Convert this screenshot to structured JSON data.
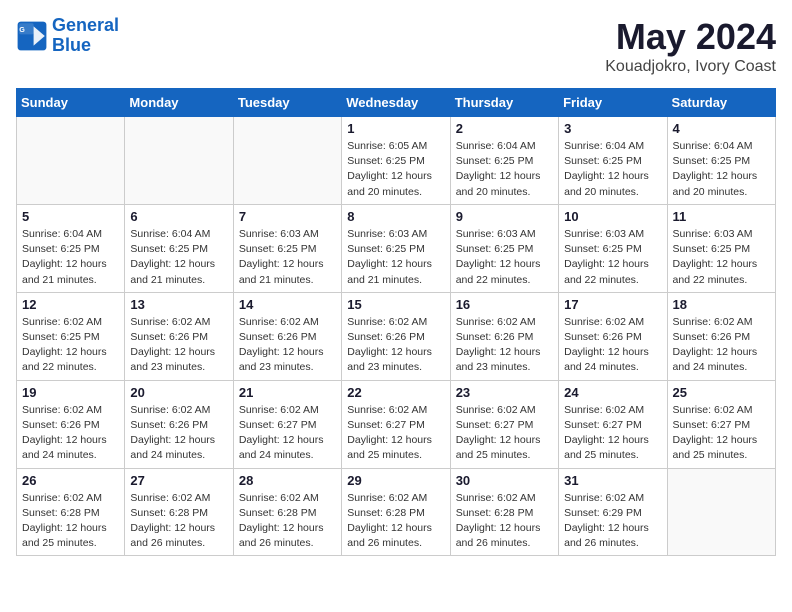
{
  "logo": {
    "line1": "General",
    "line2": "Blue"
  },
  "title": "May 2024",
  "location": "Kouadjokro, Ivory Coast",
  "weekdays": [
    "Sunday",
    "Monday",
    "Tuesday",
    "Wednesday",
    "Thursday",
    "Friday",
    "Saturday"
  ],
  "weeks": [
    [
      {
        "day": "",
        "info": ""
      },
      {
        "day": "",
        "info": ""
      },
      {
        "day": "",
        "info": ""
      },
      {
        "day": "1",
        "info": "Sunrise: 6:05 AM\nSunset: 6:25 PM\nDaylight: 12 hours\nand 20 minutes."
      },
      {
        "day": "2",
        "info": "Sunrise: 6:04 AM\nSunset: 6:25 PM\nDaylight: 12 hours\nand 20 minutes."
      },
      {
        "day": "3",
        "info": "Sunrise: 6:04 AM\nSunset: 6:25 PM\nDaylight: 12 hours\nand 20 minutes."
      },
      {
        "day": "4",
        "info": "Sunrise: 6:04 AM\nSunset: 6:25 PM\nDaylight: 12 hours\nand 20 minutes."
      }
    ],
    [
      {
        "day": "5",
        "info": "Sunrise: 6:04 AM\nSunset: 6:25 PM\nDaylight: 12 hours\nand 21 minutes."
      },
      {
        "day": "6",
        "info": "Sunrise: 6:04 AM\nSunset: 6:25 PM\nDaylight: 12 hours\nand 21 minutes."
      },
      {
        "day": "7",
        "info": "Sunrise: 6:03 AM\nSunset: 6:25 PM\nDaylight: 12 hours\nand 21 minutes."
      },
      {
        "day": "8",
        "info": "Sunrise: 6:03 AM\nSunset: 6:25 PM\nDaylight: 12 hours\nand 21 minutes."
      },
      {
        "day": "9",
        "info": "Sunrise: 6:03 AM\nSunset: 6:25 PM\nDaylight: 12 hours\nand 22 minutes."
      },
      {
        "day": "10",
        "info": "Sunrise: 6:03 AM\nSunset: 6:25 PM\nDaylight: 12 hours\nand 22 minutes."
      },
      {
        "day": "11",
        "info": "Sunrise: 6:03 AM\nSunset: 6:25 PM\nDaylight: 12 hours\nand 22 minutes."
      }
    ],
    [
      {
        "day": "12",
        "info": "Sunrise: 6:02 AM\nSunset: 6:25 PM\nDaylight: 12 hours\nand 22 minutes."
      },
      {
        "day": "13",
        "info": "Sunrise: 6:02 AM\nSunset: 6:26 PM\nDaylight: 12 hours\nand 23 minutes."
      },
      {
        "day": "14",
        "info": "Sunrise: 6:02 AM\nSunset: 6:26 PM\nDaylight: 12 hours\nand 23 minutes."
      },
      {
        "day": "15",
        "info": "Sunrise: 6:02 AM\nSunset: 6:26 PM\nDaylight: 12 hours\nand 23 minutes."
      },
      {
        "day": "16",
        "info": "Sunrise: 6:02 AM\nSunset: 6:26 PM\nDaylight: 12 hours\nand 23 minutes."
      },
      {
        "day": "17",
        "info": "Sunrise: 6:02 AM\nSunset: 6:26 PM\nDaylight: 12 hours\nand 24 minutes."
      },
      {
        "day": "18",
        "info": "Sunrise: 6:02 AM\nSunset: 6:26 PM\nDaylight: 12 hours\nand 24 minutes."
      }
    ],
    [
      {
        "day": "19",
        "info": "Sunrise: 6:02 AM\nSunset: 6:26 PM\nDaylight: 12 hours\nand 24 minutes."
      },
      {
        "day": "20",
        "info": "Sunrise: 6:02 AM\nSunset: 6:26 PM\nDaylight: 12 hours\nand 24 minutes."
      },
      {
        "day": "21",
        "info": "Sunrise: 6:02 AM\nSunset: 6:27 PM\nDaylight: 12 hours\nand 24 minutes."
      },
      {
        "day": "22",
        "info": "Sunrise: 6:02 AM\nSunset: 6:27 PM\nDaylight: 12 hours\nand 25 minutes."
      },
      {
        "day": "23",
        "info": "Sunrise: 6:02 AM\nSunset: 6:27 PM\nDaylight: 12 hours\nand 25 minutes."
      },
      {
        "day": "24",
        "info": "Sunrise: 6:02 AM\nSunset: 6:27 PM\nDaylight: 12 hours\nand 25 minutes."
      },
      {
        "day": "25",
        "info": "Sunrise: 6:02 AM\nSunset: 6:27 PM\nDaylight: 12 hours\nand 25 minutes."
      }
    ],
    [
      {
        "day": "26",
        "info": "Sunrise: 6:02 AM\nSunset: 6:28 PM\nDaylight: 12 hours\nand 25 minutes."
      },
      {
        "day": "27",
        "info": "Sunrise: 6:02 AM\nSunset: 6:28 PM\nDaylight: 12 hours\nand 26 minutes."
      },
      {
        "day": "28",
        "info": "Sunrise: 6:02 AM\nSunset: 6:28 PM\nDaylight: 12 hours\nand 26 minutes."
      },
      {
        "day": "29",
        "info": "Sunrise: 6:02 AM\nSunset: 6:28 PM\nDaylight: 12 hours\nand 26 minutes."
      },
      {
        "day": "30",
        "info": "Sunrise: 6:02 AM\nSunset: 6:28 PM\nDaylight: 12 hours\nand 26 minutes."
      },
      {
        "day": "31",
        "info": "Sunrise: 6:02 AM\nSunset: 6:29 PM\nDaylight: 12 hours\nand 26 minutes."
      },
      {
        "day": "",
        "info": ""
      }
    ]
  ]
}
